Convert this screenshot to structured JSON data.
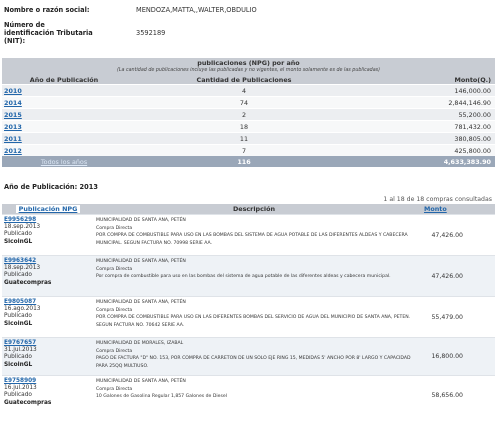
{
  "info": {
    "nombre_label": "Nombre o razón social:",
    "nombre_value": "MENDOZA,MATTA,,WALTER,OBDULIO",
    "nit_label_1": "Número de",
    "nit_label_2": "identificación Tributaria",
    "nit_label_3": "(NIT):",
    "nit_value": "3592189"
  },
  "summary": {
    "title": "publicaciones (NPG) por año",
    "note": "(La cantidad de publicaciones incluye las publicadas y no vigentes, el monto solamente es de las publicadas)",
    "col_year": "Año de Publicación",
    "col_count": "Cantidad de Publicaciones",
    "col_amount": "Monto(Q.)",
    "rows": [
      {
        "year": "2010",
        "count": "4",
        "amount": "146,000.00"
      },
      {
        "year": "2014",
        "count": "74",
        "amount": "2,844,146.90"
      },
      {
        "year": "2015",
        "count": "2",
        "amount": "55,200.00"
      },
      {
        "year": "2013",
        "count": "18",
        "amount": "781,432.00"
      },
      {
        "year": "2011",
        "count": "11",
        "amount": "380,805.00"
      },
      {
        "year": "2012",
        "count": "7",
        "amount": "425,800.00"
      }
    ],
    "total_label": "Todos los años",
    "total_count": "116",
    "total_amount": "4,633,383.90"
  },
  "year_heading": "Año de Publicación: 2013",
  "count_line": "1 al 18 de 18 compras consultadas",
  "table": {
    "col_npg": "Publicación NPG",
    "col_desc": "Descripción",
    "col_monto": "Monto",
    "rows": [
      {
        "npg": "E9956298",
        "date": "18.sep.2013",
        "status": "Publicado",
        "source": "SicoinGL",
        "entity": "MUNICIPALIDAD DE SANTA ANA, PETÉN",
        "type": "Compra Directa",
        "desc": "POR COMPRA DE COMBUSTIBLE PARA USO EN LAS BOMBAS DEL SISTEMA DE AGUA POTABLE DE LAS DIFERENTES ALDEAS Y CABECERA MUNICIPAL. SEGUN FACTURA NO. 70998 SERIE AA.",
        "amount": "47,426.00"
      },
      {
        "npg": "E9963642",
        "date": "18.sep.2013",
        "status": "Publicado",
        "source": "Guatecompras",
        "entity": "MUNICIPALIDAD DE SANTA ANA, PETÉN",
        "type": "Compra Directa",
        "desc": "Por compra de combustible para uso en las bombas del sistema de agua potable de las diferentes aldeas y cabecera municipal.",
        "amount": "47,426.00"
      },
      {
        "npg": "E9805087",
        "date": "16.ago.2013",
        "status": "Publicado",
        "source": "SicoinGL",
        "entity": "MUNICIPALIDAD DE SANTA ANA, PETÉN",
        "type": "Compra Directa",
        "desc": "POR COMPRA DE COMBUSTIBLE PARA USO EN LAS DIFERENTES BOMBAS DEL SERVICIO DE AGUA DEL MUNICIPIO DE SANTA ANA, PETEN. SEGUN FACTURA NO. 70642 SERIE AA.",
        "amount": "55,479.00"
      },
      {
        "npg": "E9767657",
        "date": "31.jul.2013",
        "status": "Publicado",
        "source": "SicoinGL",
        "entity": "MUNICIPALIDAD DE MORALES, IZABAL",
        "type": "Compra Directa",
        "desc": "PAGO DE FACTURA \"D\" NO. 153, POR COMPRA DE CARRETON DE UN SOLO EJE RING 15, MEDIDAS 5' ANCHO POR 8' LARGO Y CAPACIDAD PARA 25QQ MULTIUSO.",
        "amount": "16,800.00"
      },
      {
        "npg": "E9758909",
        "date": "16.jul.2013",
        "status": "Publicado",
        "source": "Guatecompras",
        "entity": "MUNICIPALIDAD DE SANTA ANA, PETÉN",
        "type": "Compra Directa",
        "desc": "10 Galones de Gasolina Regular 1,857 Galones de Diesel",
        "amount": "58,656.00"
      }
    ]
  },
  "colors": {
    "header_bg": "#c8ccd3",
    "link": "#2266aa",
    "total_bg": "#9aa7b8"
  }
}
